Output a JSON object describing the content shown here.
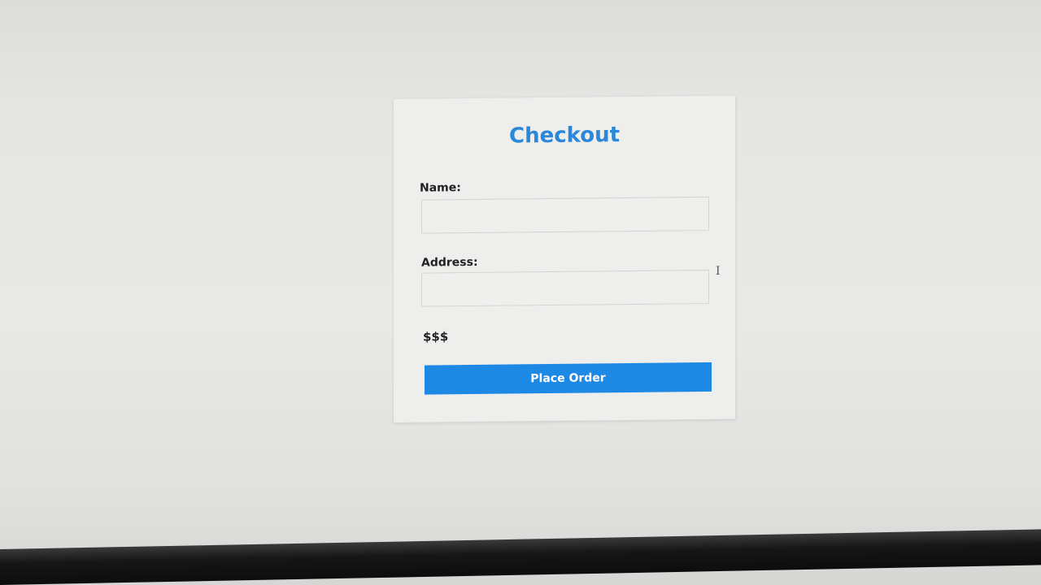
{
  "checkout": {
    "title": "Checkout",
    "name_label": "Name:",
    "name_value": "",
    "address_label": "Address:",
    "address_value": "",
    "price_text": "$$$",
    "place_order_label": "Place Order"
  },
  "colors": {
    "accent": "#1e88e5",
    "title": "#2b87d9"
  },
  "cursor_icon": "text-cursor-icon"
}
